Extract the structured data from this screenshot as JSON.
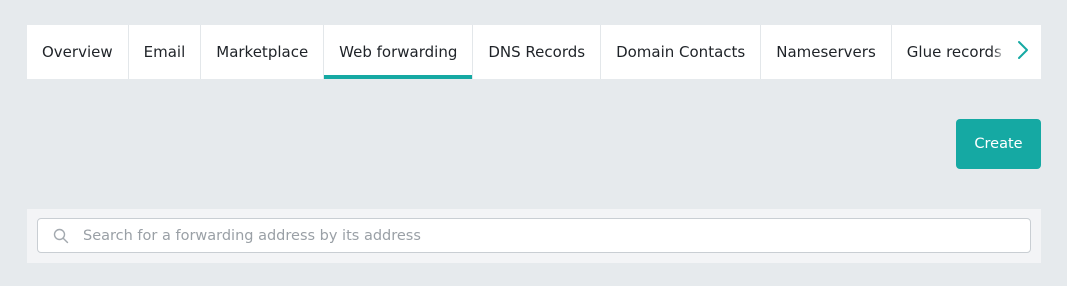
{
  "tabs": [
    {
      "label": "Overview",
      "active": false
    },
    {
      "label": "Email",
      "active": false
    },
    {
      "label": "Marketplace",
      "active": false
    },
    {
      "label": "Web forwarding",
      "active": true
    },
    {
      "label": "DNS Records",
      "active": false
    },
    {
      "label": "Domain Contacts",
      "active": false
    },
    {
      "label": "Nameservers",
      "active": false
    },
    {
      "label": "Glue records",
      "active": false
    }
  ],
  "tab_next_icon": "chevron-right-icon",
  "create_button": {
    "label": "Create"
  },
  "search": {
    "icon": "search-icon",
    "placeholder": "Search for a forwarding address by its address",
    "value": ""
  },
  "colors": {
    "accent": "#15a9a3",
    "background": "#e6eaed",
    "panel": "#ffffff"
  }
}
